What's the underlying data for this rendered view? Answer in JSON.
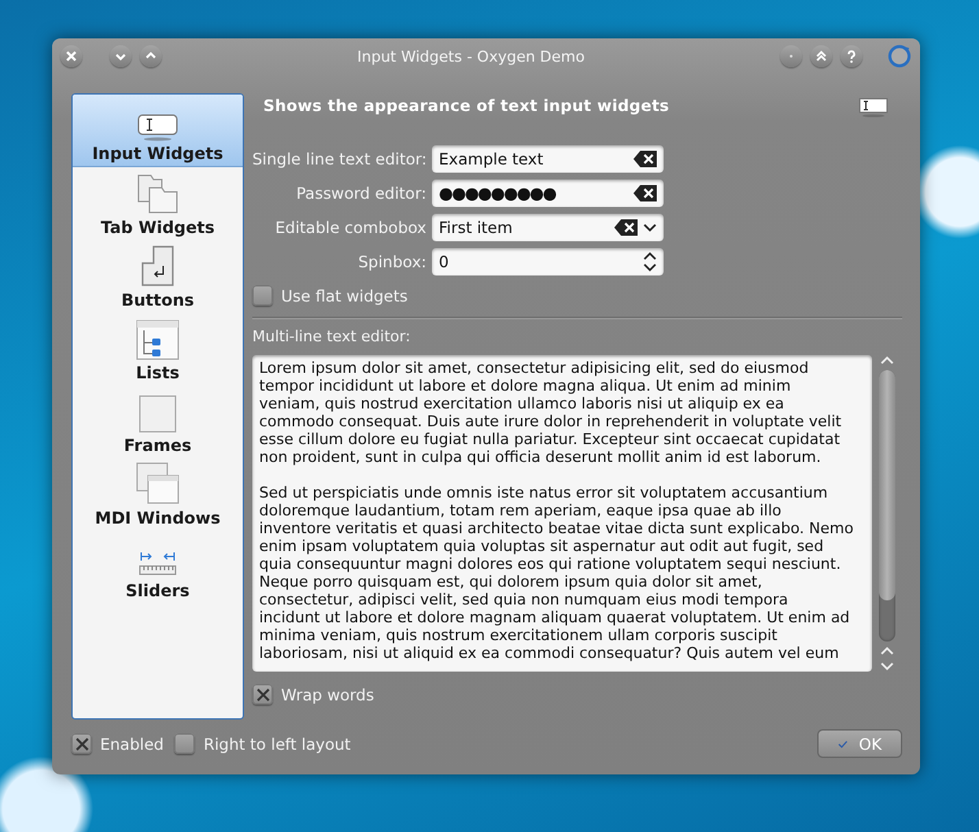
{
  "window": {
    "title": "Input Widgets - Oxygen Demo"
  },
  "sidebar": {
    "items": [
      {
        "label": "Input Widgets",
        "kind": "input",
        "selected": true
      },
      {
        "label": "Tab Widgets",
        "kind": "tabs",
        "selected": false
      },
      {
        "label": "Buttons",
        "kind": "buttons",
        "selected": false
      },
      {
        "label": "Lists",
        "kind": "lists",
        "selected": false
      },
      {
        "label": "Frames",
        "kind": "frames",
        "selected": false
      },
      {
        "label": "MDI Windows",
        "kind": "mdi",
        "selected": false
      },
      {
        "label": "Sliders",
        "kind": "sliders",
        "selected": false
      }
    ]
  },
  "header": "Shows the appearance of text input widgets",
  "fields": [
    {
      "label": "Single line text editor:",
      "kind": "text",
      "value": "Example text"
    },
    {
      "label": "Password editor:",
      "kind": "password",
      "value": "●●●●●●●●●"
    },
    {
      "label": "Editable combobox",
      "kind": "combo",
      "value": "First item"
    },
    {
      "label": "Spinbox:",
      "kind": "spin",
      "value": "0"
    }
  ],
  "flat_widgets": {
    "label": "Use flat widgets",
    "checked": false
  },
  "multiline": {
    "label": "Multi-line text editor:",
    "paragraphs": [
      [
        "Lorem ipsum dolor sit amet, consectetur adipisicing elit, sed do eiusmod",
        "tempor incididunt ut labore et dolore magna aliqua. Ut enim ad minim",
        "veniam, quis nostrud exercitation ullamco laboris nisi ut aliquip ex ea",
        "commodo consequat. Duis aute irure dolor in reprehenderit in voluptate velit",
        "esse cillum dolore eu fugiat nulla pariatur. Excepteur sint occaecat cupidatat",
        "non proident, sunt in culpa qui officia deserunt mollit anim id est laborum."
      ],
      [
        "Sed ut perspiciatis unde omnis iste natus error sit voluptatem accusantium",
        "doloremque laudantium, totam rem aperiam, eaque ipsa quae ab illo",
        "inventore veritatis et quasi architecto beatae vitae dicta sunt explicabo. Nemo",
        "enim ipsam voluptatem quia voluptas sit aspernatur aut odit aut fugit, sed",
        "quia consequuntur magni dolores eos qui ratione voluptatem sequi nesciunt.",
        "Neque porro quisquam est, qui dolorem ipsum quia dolor sit amet,",
        "consectetur, adipisci velit, sed quia non numquam eius modi tempora",
        "incidunt ut labore et dolore magnam aliquam quaerat voluptatem. Ut enim ad",
        "minima veniam, quis nostrum exercitationem ullam corporis suscipit",
        "laboriosam, nisi ut aliquid ex ea commodi consequatur? Quis autem vel eum"
      ]
    ]
  },
  "wrap_words": {
    "label": "Wrap words",
    "checked": true
  },
  "enabled": {
    "label": "Enabled",
    "checked": true
  },
  "right_to_left": {
    "label": "Right to left layout",
    "checked": false
  },
  "ok_button": "OK"
}
